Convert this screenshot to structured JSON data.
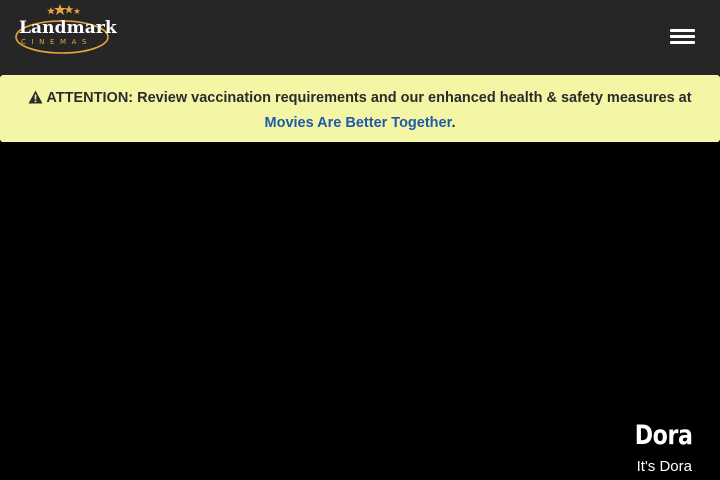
{
  "brand": {
    "logo_word": "Landmark",
    "logo_sub": "CINEMAS",
    "accent_color": "#e7a63b"
  },
  "header": {
    "menu_icon": "hamburger-menu-icon"
  },
  "alert": {
    "icon": "warning-triangle-icon",
    "text": "ATTENTION: Review vaccination requirements and our enhanced health & safety measures at",
    "link_label": "Movies Are Better Together",
    "trailing": "."
  },
  "hero": {
    "title": "Dora",
    "subtitle": "It's Dora"
  },
  "colors": {
    "topbar": "#262626",
    "alert_bg": "#f5f5a6",
    "link": "#1e5aa8",
    "page_bg": "#000000"
  }
}
